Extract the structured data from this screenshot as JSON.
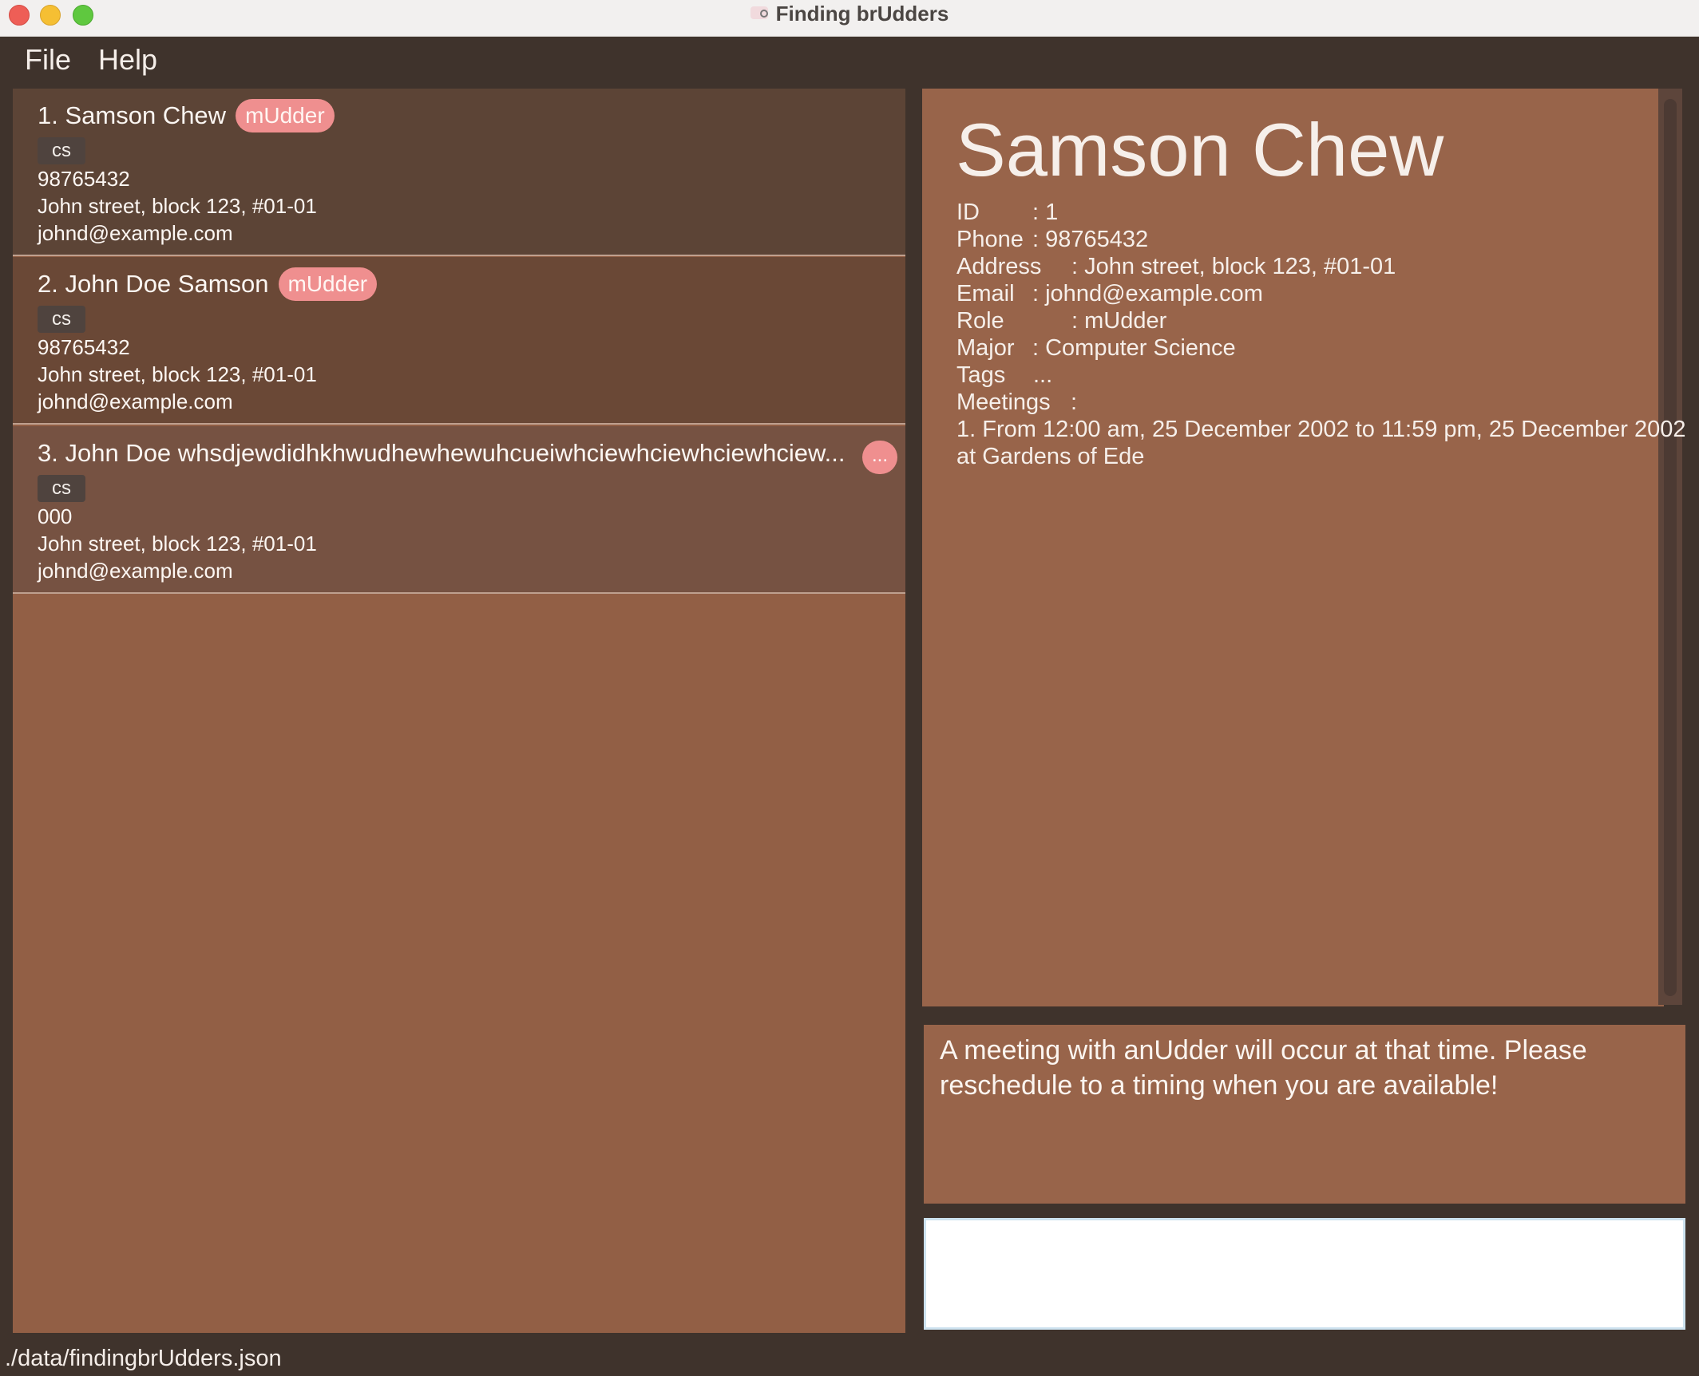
{
  "window": {
    "title": "Finding brUdders"
  },
  "menu": {
    "file": "File",
    "help": "Help"
  },
  "persons": [
    {
      "name": "1. Samson Chew",
      "role": "mUdder",
      "tag": "cs",
      "phone": "98765432",
      "address": "John street, block 123, #01-01",
      "email": "johnd@example.com"
    },
    {
      "name": "2. John Doe Samson",
      "role": "mUdder",
      "tag": "cs",
      "phone": "98765432",
      "address": "John street, block 123, #01-01",
      "email": "johnd@example.com"
    },
    {
      "name": "3. John Doe whsdjewdidhkhwudhewhewuhcueiwhciewhciewhciewhciew...",
      "role": "...",
      "tag": "cs",
      "phone": "000",
      "address": "John street, block 123, #01-01",
      "email": "johnd@example.com"
    }
  ],
  "detail": {
    "name": "Samson Chew",
    "labels": {
      "id": "ID",
      "phone": "Phone",
      "address": "Address",
      "email": "Email",
      "role": "Role",
      "major": "Major",
      "tags": "Tags",
      "meetings": "Meetings"
    },
    "values": {
      "id": ": 1",
      "phone": ": 98765432",
      "address": ": John street, block 123, #01-01",
      "email": ": johnd@example.com",
      "role": ": mUdder",
      "major": ": Computer Science",
      "tags": "...",
      "meetings": ":"
    },
    "meeting_line1": "1. From 12:00 am, 25 December 2002 to 11:59 pm, 25 December 2002",
    "meeting_line2": "at Gardens of Ede"
  },
  "result": {
    "line1": "A meeting with anUdder will occur at that time. Please",
    "line2": "reschedule to a timing when you are available!"
  },
  "command": {
    "value": ""
  },
  "status": {
    "path": "./data/findingbrUdders.json"
  },
  "colors": {
    "card_bg": [
      "#5c4436",
      "#6a4836",
      "#765242"
    ],
    "panel": "#925f45",
    "badge": "#ef8f8f"
  }
}
